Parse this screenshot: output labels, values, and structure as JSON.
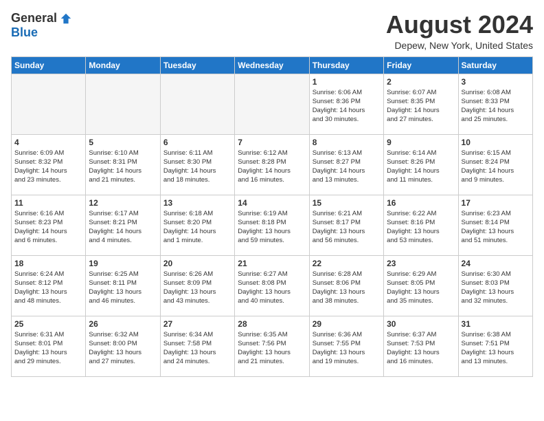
{
  "header": {
    "logo_general": "General",
    "logo_blue": "Blue",
    "month_title": "August 2024",
    "location": "Depew, New York, United States"
  },
  "days_of_week": [
    "Sunday",
    "Monday",
    "Tuesday",
    "Wednesday",
    "Thursday",
    "Friday",
    "Saturday"
  ],
  "weeks": [
    [
      {
        "day": "",
        "info": ""
      },
      {
        "day": "",
        "info": ""
      },
      {
        "day": "",
        "info": ""
      },
      {
        "day": "",
        "info": ""
      },
      {
        "day": "1",
        "info": "Sunrise: 6:06 AM\nSunset: 8:36 PM\nDaylight: 14 hours\nand 30 minutes."
      },
      {
        "day": "2",
        "info": "Sunrise: 6:07 AM\nSunset: 8:35 PM\nDaylight: 14 hours\nand 27 minutes."
      },
      {
        "day": "3",
        "info": "Sunrise: 6:08 AM\nSunset: 8:33 PM\nDaylight: 14 hours\nand 25 minutes."
      }
    ],
    [
      {
        "day": "4",
        "info": "Sunrise: 6:09 AM\nSunset: 8:32 PM\nDaylight: 14 hours\nand 23 minutes."
      },
      {
        "day": "5",
        "info": "Sunrise: 6:10 AM\nSunset: 8:31 PM\nDaylight: 14 hours\nand 21 minutes."
      },
      {
        "day": "6",
        "info": "Sunrise: 6:11 AM\nSunset: 8:30 PM\nDaylight: 14 hours\nand 18 minutes."
      },
      {
        "day": "7",
        "info": "Sunrise: 6:12 AM\nSunset: 8:28 PM\nDaylight: 14 hours\nand 16 minutes."
      },
      {
        "day": "8",
        "info": "Sunrise: 6:13 AM\nSunset: 8:27 PM\nDaylight: 14 hours\nand 13 minutes."
      },
      {
        "day": "9",
        "info": "Sunrise: 6:14 AM\nSunset: 8:26 PM\nDaylight: 14 hours\nand 11 minutes."
      },
      {
        "day": "10",
        "info": "Sunrise: 6:15 AM\nSunset: 8:24 PM\nDaylight: 14 hours\nand 9 minutes."
      }
    ],
    [
      {
        "day": "11",
        "info": "Sunrise: 6:16 AM\nSunset: 8:23 PM\nDaylight: 14 hours\nand 6 minutes."
      },
      {
        "day": "12",
        "info": "Sunrise: 6:17 AM\nSunset: 8:21 PM\nDaylight: 14 hours\nand 4 minutes."
      },
      {
        "day": "13",
        "info": "Sunrise: 6:18 AM\nSunset: 8:20 PM\nDaylight: 14 hours\nand 1 minute."
      },
      {
        "day": "14",
        "info": "Sunrise: 6:19 AM\nSunset: 8:18 PM\nDaylight: 13 hours\nand 59 minutes."
      },
      {
        "day": "15",
        "info": "Sunrise: 6:21 AM\nSunset: 8:17 PM\nDaylight: 13 hours\nand 56 minutes."
      },
      {
        "day": "16",
        "info": "Sunrise: 6:22 AM\nSunset: 8:16 PM\nDaylight: 13 hours\nand 53 minutes."
      },
      {
        "day": "17",
        "info": "Sunrise: 6:23 AM\nSunset: 8:14 PM\nDaylight: 13 hours\nand 51 minutes."
      }
    ],
    [
      {
        "day": "18",
        "info": "Sunrise: 6:24 AM\nSunset: 8:12 PM\nDaylight: 13 hours\nand 48 minutes."
      },
      {
        "day": "19",
        "info": "Sunrise: 6:25 AM\nSunset: 8:11 PM\nDaylight: 13 hours\nand 46 minutes."
      },
      {
        "day": "20",
        "info": "Sunrise: 6:26 AM\nSunset: 8:09 PM\nDaylight: 13 hours\nand 43 minutes."
      },
      {
        "day": "21",
        "info": "Sunrise: 6:27 AM\nSunset: 8:08 PM\nDaylight: 13 hours\nand 40 minutes."
      },
      {
        "day": "22",
        "info": "Sunrise: 6:28 AM\nSunset: 8:06 PM\nDaylight: 13 hours\nand 38 minutes."
      },
      {
        "day": "23",
        "info": "Sunrise: 6:29 AM\nSunset: 8:05 PM\nDaylight: 13 hours\nand 35 minutes."
      },
      {
        "day": "24",
        "info": "Sunrise: 6:30 AM\nSunset: 8:03 PM\nDaylight: 13 hours\nand 32 minutes."
      }
    ],
    [
      {
        "day": "25",
        "info": "Sunrise: 6:31 AM\nSunset: 8:01 PM\nDaylight: 13 hours\nand 29 minutes."
      },
      {
        "day": "26",
        "info": "Sunrise: 6:32 AM\nSunset: 8:00 PM\nDaylight: 13 hours\nand 27 minutes."
      },
      {
        "day": "27",
        "info": "Sunrise: 6:34 AM\nSunset: 7:58 PM\nDaylight: 13 hours\nand 24 minutes."
      },
      {
        "day": "28",
        "info": "Sunrise: 6:35 AM\nSunset: 7:56 PM\nDaylight: 13 hours\nand 21 minutes."
      },
      {
        "day": "29",
        "info": "Sunrise: 6:36 AM\nSunset: 7:55 PM\nDaylight: 13 hours\nand 19 minutes."
      },
      {
        "day": "30",
        "info": "Sunrise: 6:37 AM\nSunset: 7:53 PM\nDaylight: 13 hours\nand 16 minutes."
      },
      {
        "day": "31",
        "info": "Sunrise: 6:38 AM\nSunset: 7:51 PM\nDaylight: 13 hours\nand 13 minutes."
      }
    ]
  ]
}
